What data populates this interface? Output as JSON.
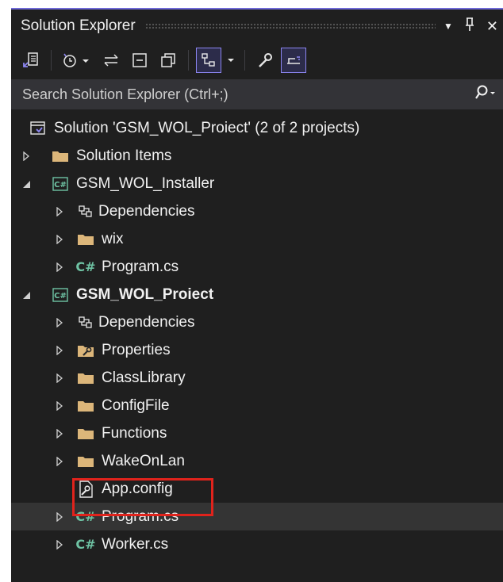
{
  "panel": {
    "title": "Solution Explorer",
    "pin_glyph": "Ш",
    "close_glyph": "✕",
    "dropdown_glyph": "▼"
  },
  "toolbar": {
    "icons": [
      "sync-with-active-document-icon",
      "pending-changes-filter-icon",
      "back-forward-icon",
      "collapse-all-icon",
      "show-all-files-icon",
      "switch-views-icon",
      "properties-icon",
      "preview-selected-items-icon"
    ]
  },
  "search": {
    "placeholder": "Search Solution Explorer (Ctrl+;)"
  },
  "tree": {
    "solution": "Solution 'GSM_WOL_Proiect' (2 of 2 projects)",
    "solution_items": "Solution Items",
    "installer": {
      "name": "GSM_WOL_Installer",
      "dependencies": "Dependencies",
      "wix": "wix",
      "program": "Program.cs"
    },
    "project": {
      "name": "GSM_WOL_Proiect",
      "dependencies": "Dependencies",
      "properties": "Properties",
      "class_library": "ClassLibrary",
      "config_file": "ConfigFile",
      "functions": "Functions",
      "wake_on_lan": "WakeOnLan",
      "app_config": "App.config",
      "program": "Program.cs",
      "worker": "Worker.cs"
    }
  },
  "cs_label": "C#",
  "colors": {
    "accent": "#6f6ad8",
    "folder": "#dcb67a",
    "csharp": "#6ec2a3",
    "highlight": "#e0231c"
  }
}
